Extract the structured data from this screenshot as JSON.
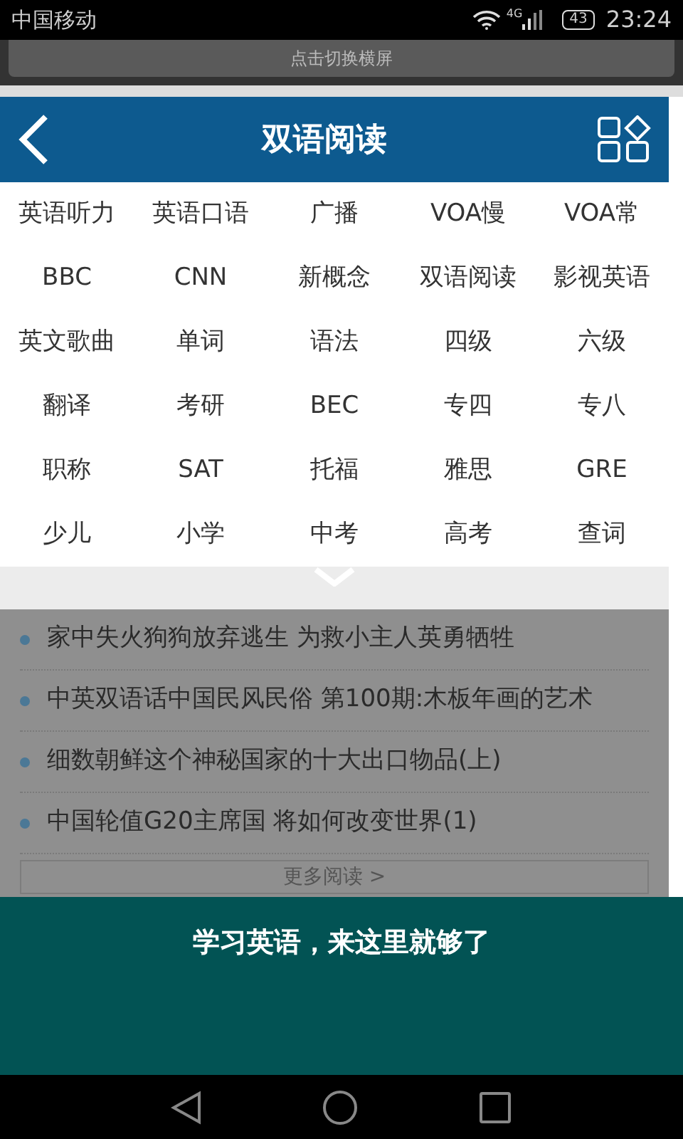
{
  "status_bar": {
    "carrier": "中国移动",
    "network": "4G",
    "battery": "43",
    "time": "23:24"
  },
  "rotate_button": {
    "label": "点击切换横屏"
  },
  "header": {
    "title": "双语阅读"
  },
  "categories": [
    {
      "label": "英语听力",
      "selected": false
    },
    {
      "label": "英语口语",
      "selected": false
    },
    {
      "label": "广播",
      "selected": false
    },
    {
      "label": "VOA慢",
      "selected": false
    },
    {
      "label": "VOA常",
      "selected": false
    },
    {
      "label": "BBC",
      "selected": false
    },
    {
      "label": "CNN",
      "selected": false
    },
    {
      "label": "新概念",
      "selected": false
    },
    {
      "label": "双语阅读",
      "selected": false
    },
    {
      "label": "影视英语",
      "selected": false
    },
    {
      "label": "英文歌曲",
      "selected": false
    },
    {
      "label": "单词",
      "selected": false
    },
    {
      "label": "语法",
      "selected": false
    },
    {
      "label": "四级",
      "selected": false
    },
    {
      "label": "六级",
      "selected": false
    },
    {
      "label": "翻译",
      "selected": false
    },
    {
      "label": "考研",
      "selected": false
    },
    {
      "label": "BEC",
      "selected": false
    },
    {
      "label": "专四",
      "selected": false
    },
    {
      "label": "专八",
      "selected": false
    },
    {
      "label": "职称",
      "selected": false
    },
    {
      "label": "SAT",
      "selected": false
    },
    {
      "label": "托福",
      "selected": false
    },
    {
      "label": "雅思",
      "selected": false
    },
    {
      "label": "GRE",
      "selected": false
    },
    {
      "label": "少儿",
      "selected": false
    },
    {
      "label": "小学",
      "selected": false
    },
    {
      "label": "中考",
      "selected": false
    },
    {
      "label": "高考",
      "selected": false
    },
    {
      "label": "查词",
      "selected": false
    }
  ],
  "articles": [
    "家中失火狗狗放弃逃生 为救小主人英勇牺牲",
    "中英双语话中国民风民俗 第100期:木板年画的艺术",
    "细数朝鲜这个神秘国家的十大出口物品(上)",
    "中国轮值G20主席国 将如何改变世界(1)"
  ],
  "more_button": {
    "label": "更多阅读 >"
  },
  "banner": {
    "text": "学习英语，来这里就够了"
  }
}
